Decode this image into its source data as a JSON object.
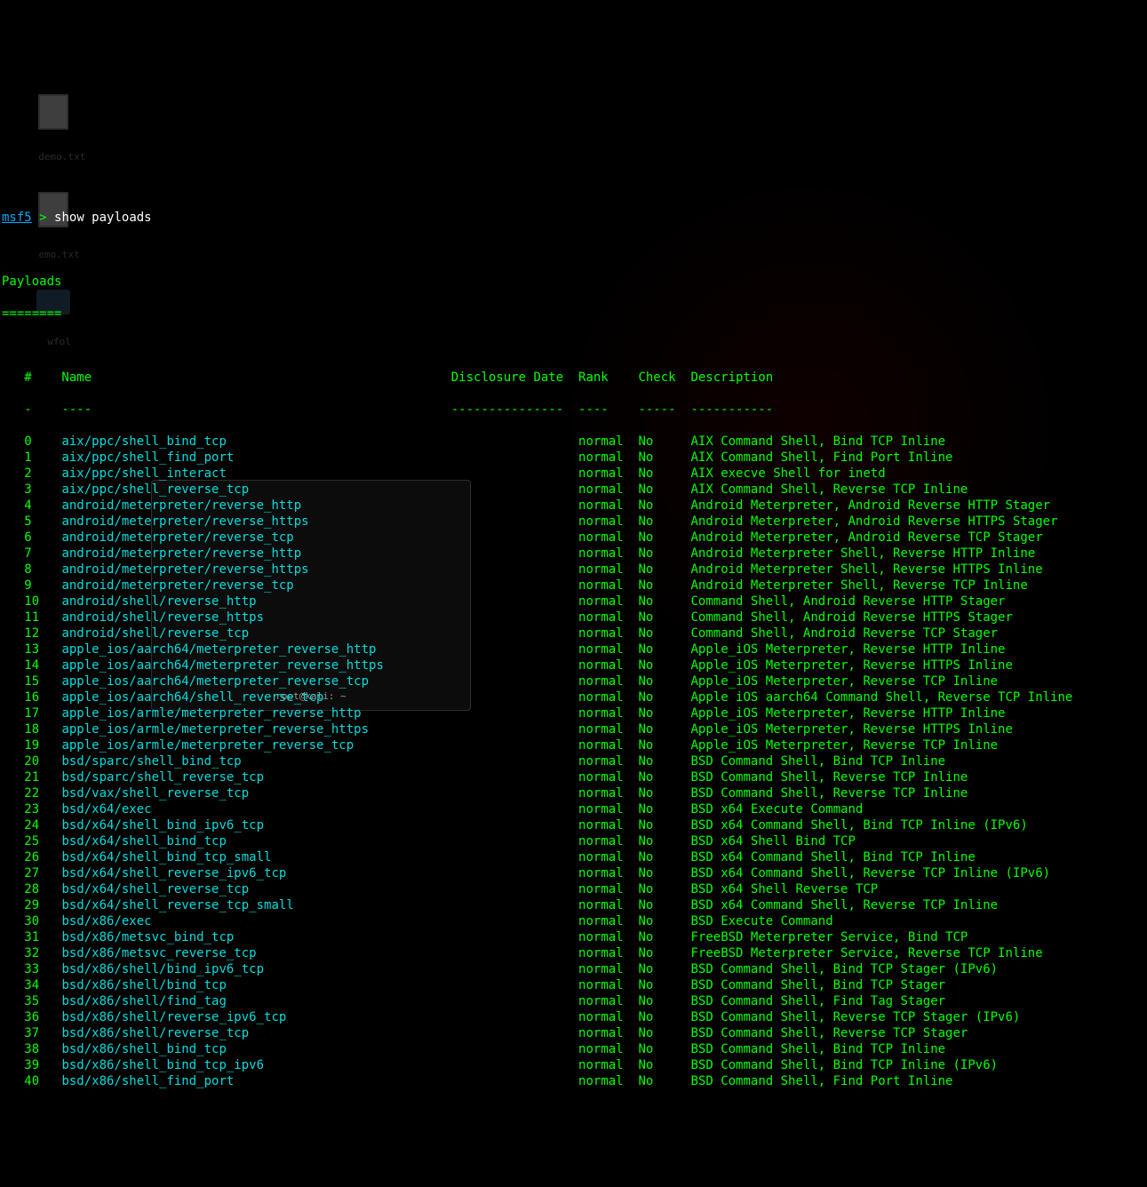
{
  "prompt": {
    "prefix": "msf5",
    "gt": ">",
    "command": "show payloads"
  },
  "section_title": "Payloads",
  "section_underline": "========",
  "headers": {
    "idx": "#",
    "name": "Name",
    "disclosure": "Disclosure Date",
    "rank": "Rank",
    "check": "Check",
    "description": "Description"
  },
  "dashes": {
    "idx": "-",
    "name": "----",
    "disclosure": "---------------",
    "rank": "----",
    "check": "-----",
    "description": "-----------"
  },
  "rows": [
    {
      "idx": "0",
      "name": "aix/ppc/shell_bind_tcp",
      "rank": "normal",
      "check": "No",
      "desc": "AIX Command Shell, Bind TCP Inline"
    },
    {
      "idx": "1",
      "name": "aix/ppc/shell_find_port",
      "rank": "normal",
      "check": "No",
      "desc": "AIX Command Shell, Find Port Inline"
    },
    {
      "idx": "2",
      "name": "aix/ppc/shell_interact",
      "rank": "normal",
      "check": "No",
      "desc": "AIX execve Shell for inetd"
    },
    {
      "idx": "3",
      "name": "aix/ppc/shell_reverse_tcp",
      "rank": "normal",
      "check": "No",
      "desc": "AIX Command Shell, Reverse TCP Inline"
    },
    {
      "idx": "4",
      "name": "android/meterpreter/reverse_http",
      "rank": "normal",
      "check": "No",
      "desc": "Android Meterpreter, Android Reverse HTTP Stager"
    },
    {
      "idx": "5",
      "name": "android/meterpreter/reverse_https",
      "rank": "normal",
      "check": "No",
      "desc": "Android Meterpreter, Android Reverse HTTPS Stager"
    },
    {
      "idx": "6",
      "name": "android/meterpreter/reverse_tcp",
      "rank": "normal",
      "check": "No",
      "desc": "Android Meterpreter, Android Reverse TCP Stager"
    },
    {
      "idx": "7",
      "name": "android/meterpreter/reverse_http",
      "rank": "normal",
      "check": "No",
      "desc": "Android Meterpreter Shell, Reverse HTTP Inline"
    },
    {
      "idx": "8",
      "name": "android/meterpreter/reverse_https",
      "rank": "normal",
      "check": "No",
      "desc": "Android Meterpreter Shell, Reverse HTTPS Inline"
    },
    {
      "idx": "9",
      "name": "android/meterpreter/reverse_tcp",
      "rank": "normal",
      "check": "No",
      "desc": "Android Meterpreter Shell, Reverse TCP Inline"
    },
    {
      "idx": "10",
      "name": "android/shell/reverse_http",
      "rank": "normal",
      "check": "No",
      "desc": "Command Shell, Android Reverse HTTP Stager"
    },
    {
      "idx": "11",
      "name": "android/shell/reverse_https",
      "rank": "normal",
      "check": "No",
      "desc": "Command Shell, Android Reverse HTTPS Stager"
    },
    {
      "idx": "12",
      "name": "android/shell/reverse_tcp",
      "rank": "normal",
      "check": "No",
      "desc": "Command Shell, Android Reverse TCP Stager"
    },
    {
      "idx": "13",
      "name": "apple_ios/aarch64/meterpreter_reverse_http",
      "rank": "normal",
      "check": "No",
      "desc": "Apple_iOS Meterpreter, Reverse HTTP Inline"
    },
    {
      "idx": "14",
      "name": "apple_ios/aarch64/meterpreter_reverse_https",
      "rank": "normal",
      "check": "No",
      "desc": "Apple_iOS Meterpreter, Reverse HTTPS Inline"
    },
    {
      "idx": "15",
      "name": "apple_ios/aarch64/meterpreter_reverse_tcp",
      "rank": "normal",
      "check": "No",
      "desc": "Apple_iOS Meterpreter, Reverse TCP Inline"
    },
    {
      "idx": "16",
      "name": "apple_ios/aarch64/shell_reverse_tcp",
      "rank": "normal",
      "check": "No",
      "desc": "Apple iOS aarch64 Command Shell, Reverse TCP Inline"
    },
    {
      "idx": "17",
      "name": "apple_ios/armle/meterpreter_reverse_http",
      "rank": "normal",
      "check": "No",
      "desc": "Apple_iOS Meterpreter, Reverse HTTP Inline"
    },
    {
      "idx": "18",
      "name": "apple_ios/armle/meterpreter_reverse_https",
      "rank": "normal",
      "check": "No",
      "desc": "Apple_iOS Meterpreter, Reverse HTTPS Inline"
    },
    {
      "idx": "19",
      "name": "apple_ios/armle/meterpreter_reverse_tcp",
      "rank": "normal",
      "check": "No",
      "desc": "Apple_iOS Meterpreter, Reverse TCP Inline"
    },
    {
      "idx": "20",
      "name": "bsd/sparc/shell_bind_tcp",
      "rank": "normal",
      "check": "No",
      "desc": "BSD Command Shell, Bind TCP Inline"
    },
    {
      "idx": "21",
      "name": "bsd/sparc/shell_reverse_tcp",
      "rank": "normal",
      "check": "No",
      "desc": "BSD Command Shell, Reverse TCP Inline"
    },
    {
      "idx": "22",
      "name": "bsd/vax/shell_reverse_tcp",
      "rank": "normal",
      "check": "No",
      "desc": "BSD Command Shell, Reverse TCP Inline"
    },
    {
      "idx": "23",
      "name": "bsd/x64/exec",
      "rank": "normal",
      "check": "No",
      "desc": "BSD x64 Execute Command"
    },
    {
      "idx": "24",
      "name": "bsd/x64/shell_bind_ipv6_tcp",
      "rank": "normal",
      "check": "No",
      "desc": "BSD x64 Command Shell, Bind TCP Inline (IPv6)"
    },
    {
      "idx": "25",
      "name": "bsd/x64/shell_bind_tcp",
      "rank": "normal",
      "check": "No",
      "desc": "BSD x64 Shell Bind TCP"
    },
    {
      "idx": "26",
      "name": "bsd/x64/shell_bind_tcp_small",
      "rank": "normal",
      "check": "No",
      "desc": "BSD x64 Command Shell, Bind TCP Inline"
    },
    {
      "idx": "27",
      "name": "bsd/x64/shell_reverse_ipv6_tcp",
      "rank": "normal",
      "check": "No",
      "desc": "BSD x64 Command Shell, Reverse TCP Inline (IPv6)"
    },
    {
      "idx": "28",
      "name": "bsd/x64/shell_reverse_tcp",
      "rank": "normal",
      "check": "No",
      "desc": "BSD x64 Shell Reverse TCP"
    },
    {
      "idx": "29",
      "name": "bsd/x64/shell_reverse_tcp_small",
      "rank": "normal",
      "check": "No",
      "desc": "BSD x64 Command Shell, Reverse TCP Inline"
    },
    {
      "idx": "30",
      "name": "bsd/x86/exec",
      "rank": "normal",
      "check": "No",
      "desc": "BSD Execute Command"
    },
    {
      "idx": "31",
      "name": "bsd/x86/metsvc_bind_tcp",
      "rank": "normal",
      "check": "No",
      "desc": "FreeBSD Meterpreter Service, Bind TCP"
    },
    {
      "idx": "32",
      "name": "bsd/x86/metsvc_reverse_tcp",
      "rank": "normal",
      "check": "No",
      "desc": "FreeBSD Meterpreter Service, Reverse TCP Inline"
    },
    {
      "idx": "33",
      "name": "bsd/x86/shell/bind_ipv6_tcp",
      "rank": "normal",
      "check": "No",
      "desc": "BSD Command Shell, Bind TCP Stager (IPv6)"
    },
    {
      "idx": "34",
      "name": "bsd/x86/shell/bind_tcp",
      "rank": "normal",
      "check": "No",
      "desc": "BSD Command Shell, Bind TCP Stager"
    },
    {
      "idx": "35",
      "name": "bsd/x86/shell/find_tag",
      "rank": "normal",
      "check": "No",
      "desc": "BSD Command Shell, Find Tag Stager"
    },
    {
      "idx": "36",
      "name": "bsd/x86/shell/reverse_ipv6_tcp",
      "rank": "normal",
      "check": "No",
      "desc": "BSD Command Shell, Reverse TCP Stager (IPv6)"
    },
    {
      "idx": "37",
      "name": "bsd/x86/shell/reverse_tcp",
      "rank": "normal",
      "check": "No",
      "desc": "BSD Command Shell, Reverse TCP Stager"
    },
    {
      "idx": "38",
      "name": "bsd/x86/shell_bind_tcp",
      "rank": "normal",
      "check": "No",
      "desc": "BSD Command Shell, Bind TCP Inline"
    },
    {
      "idx": "39",
      "name": "bsd/x86/shell_bind_tcp_ipv6",
      "rank": "normal",
      "check": "No",
      "desc": "BSD Command Shell, Bind TCP Inline (IPv6)"
    },
    {
      "idx": "40",
      "name": "bsd/x86/shell_find_port",
      "rank": "normal",
      "check": "No",
      "desc": "BSD Command Shell, Find Port Inline"
    }
  ],
  "desktop": {
    "file1": "demo.txt",
    "file2": "emo.txt",
    "folder": "wfol"
  },
  "preview": {
    "title": "root@kali: ~"
  }
}
